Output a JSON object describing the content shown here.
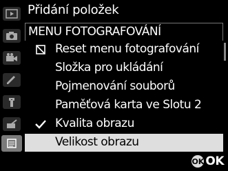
{
  "header": {
    "title": "Přidání položek"
  },
  "section": {
    "label": "MENU FOTOGRAFOVÁNÍ"
  },
  "sidebar": {
    "tabs": [
      {
        "icon": "playback-icon"
      },
      {
        "icon": "camera-icon"
      },
      {
        "icon": "movie-camera-icon"
      },
      {
        "icon": "pencil-icon"
      },
      {
        "icon": "wrench-icon"
      },
      {
        "icon": "retouch-icon"
      },
      {
        "icon": "my-menu-icon",
        "active": true
      }
    ]
  },
  "items": [
    {
      "label": "Reset menu fotografování",
      "mark": "disabled-box-icon"
    },
    {
      "label": "Složka pro ukládání",
      "mark": ""
    },
    {
      "label": "Pojmenování souborů",
      "mark": ""
    },
    {
      "label": "Paměťová karta ve Slotu 2",
      "mark": ""
    },
    {
      "label": "Kvalita obrazu",
      "mark": "checkmark-icon"
    },
    {
      "label": "Velikost obrazu",
      "mark": "",
      "selected": true
    }
  ],
  "footer": {
    "ok_button": "OK",
    "ok_label": "OK"
  },
  "colors": {
    "selected_row": "#dedede",
    "active_tab": "#7a7a7a"
  }
}
